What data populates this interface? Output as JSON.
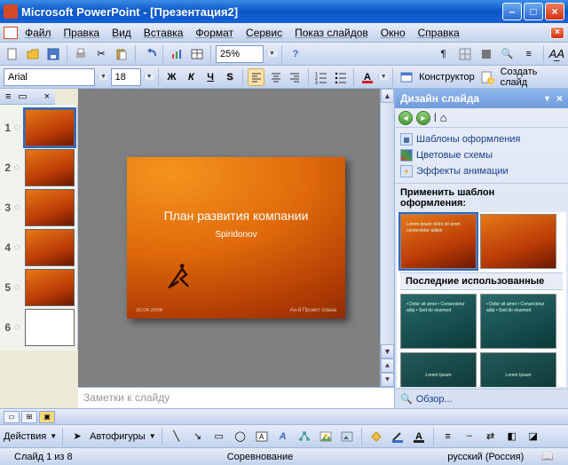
{
  "window": {
    "title": "Microsoft PowerPoint - [Презентация2]"
  },
  "menu": {
    "file": "Файл",
    "edit": "Правка",
    "view": "Вид",
    "insert": "Вставка",
    "format": "Формат",
    "tools": "Сервис",
    "slideshow": "Показ слайдов",
    "window": "Окно",
    "help": "Справка"
  },
  "toolbar": {
    "zoom": "25%"
  },
  "format": {
    "font": "Arial",
    "size": "18",
    "bold": "Ж",
    "italic": "К",
    "underline": "Ч",
    "shadow": "S",
    "designer": "Конструктор",
    "newslide": "Создать слайд"
  },
  "thumbs": {
    "count": 6,
    "closeX": "×"
  },
  "slide": {
    "title": "План развития компании",
    "subtitle": "Spiridonov",
    "date": "30.04.2006",
    "footer": "Ан-й Проект плана"
  },
  "notes": {
    "placeholder": "Заметки к слайду"
  },
  "taskpane": {
    "title": "Дизайн слайда",
    "link_templates": "Шаблоны оформления",
    "link_colors": "Цветовые схемы",
    "link_anim": "Эффекты анимации",
    "apply_label": "Применить шаблон оформления:",
    "recent_label": "Последние использованные",
    "browse": "Обзор...",
    "dropdown": "▼",
    "close": "×"
  },
  "drawbar": {
    "actions": "Действия",
    "autoshapes": "Автофигуры"
  },
  "status": {
    "slide": "Слайд 1 из 8",
    "template": "Соревнование",
    "lang": "русский (Россия)"
  },
  "template_thumbs": {
    "orange1_lines": "Lorem ipsum dolor sit amet consectetur adipis",
    "teal_lines": "• Dolor sit amet\n• Consectetur adip\n• Sed do eiusmod",
    "teal_title": "Lorem Ipsum"
  }
}
